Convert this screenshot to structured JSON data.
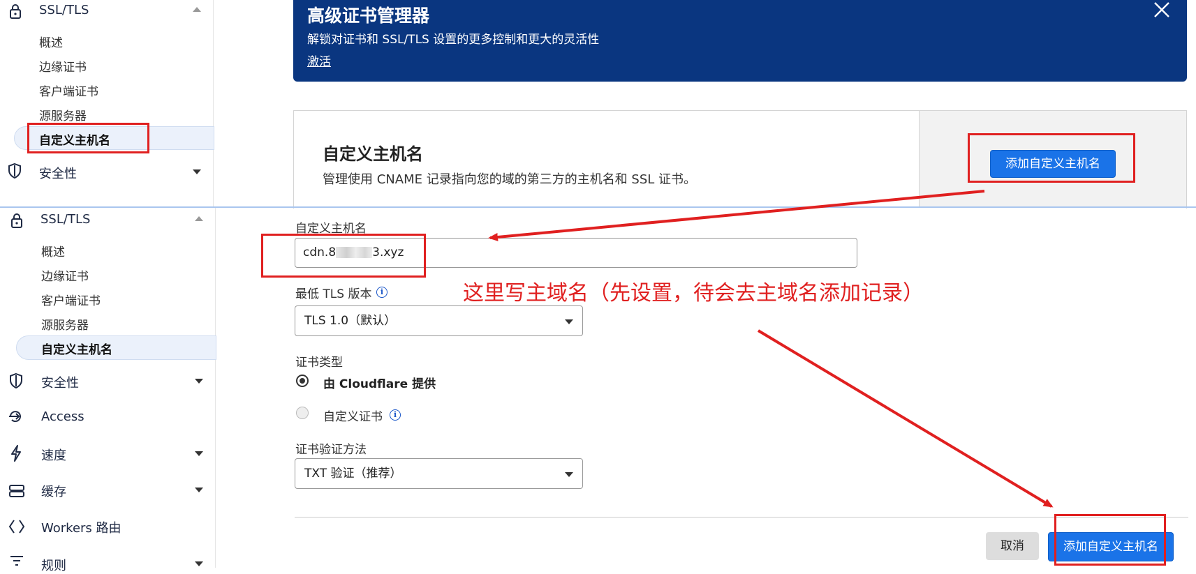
{
  "sidebar_top": {
    "section_title": "SSL/TLS",
    "items": [
      "概述",
      "边缘证书",
      "客户端证书",
      "源服务器",
      "自定义主机名"
    ],
    "security": "安全性"
  },
  "sidebar_bottom": {
    "section_title": "SSL/TLS",
    "items": [
      "概述",
      "边缘证书",
      "客户端证书",
      "源服务器",
      "自定义主机名"
    ],
    "nav": [
      "安全性",
      "Access",
      "速度",
      "缓存",
      "Workers 路由",
      "规则"
    ]
  },
  "banner": {
    "title": "高级证书管理器",
    "description": "解锁对证书和 SSL/TLS 设置的更多控制和更大的灵活性",
    "link": "激活"
  },
  "card": {
    "title": "自定义主机名",
    "description": "管理使用 CNAME 记录指向您的域的第三方的主机名和 SSL 证书。",
    "button": "添加自定义主机名"
  },
  "form": {
    "hostname_label": "自定义主机名",
    "hostname_value": "cdn.8",
    "hostname_value_tail": "3.xyz",
    "min_tls_label": "最低 TLS 版本",
    "min_tls_value": "TLS 1.0（默认）",
    "cert_type_label": "证书类型",
    "cert_option_cloudflare": "由 Cloudflare 提供",
    "cert_option_custom": "自定义证书",
    "validation_label": "证书验证方法",
    "validation_value": "TXT 验证（推荐）",
    "cancel": "取消",
    "submit": "添加自定义主机名"
  },
  "annotation": {
    "text": "这里写主域名（先设置，待会去主域名添加记录）",
    "color": "#e02020"
  },
  "colors": {
    "banner_bg": "#0a3680",
    "primary": "#1a73e8",
    "annotation": "#e02020"
  }
}
